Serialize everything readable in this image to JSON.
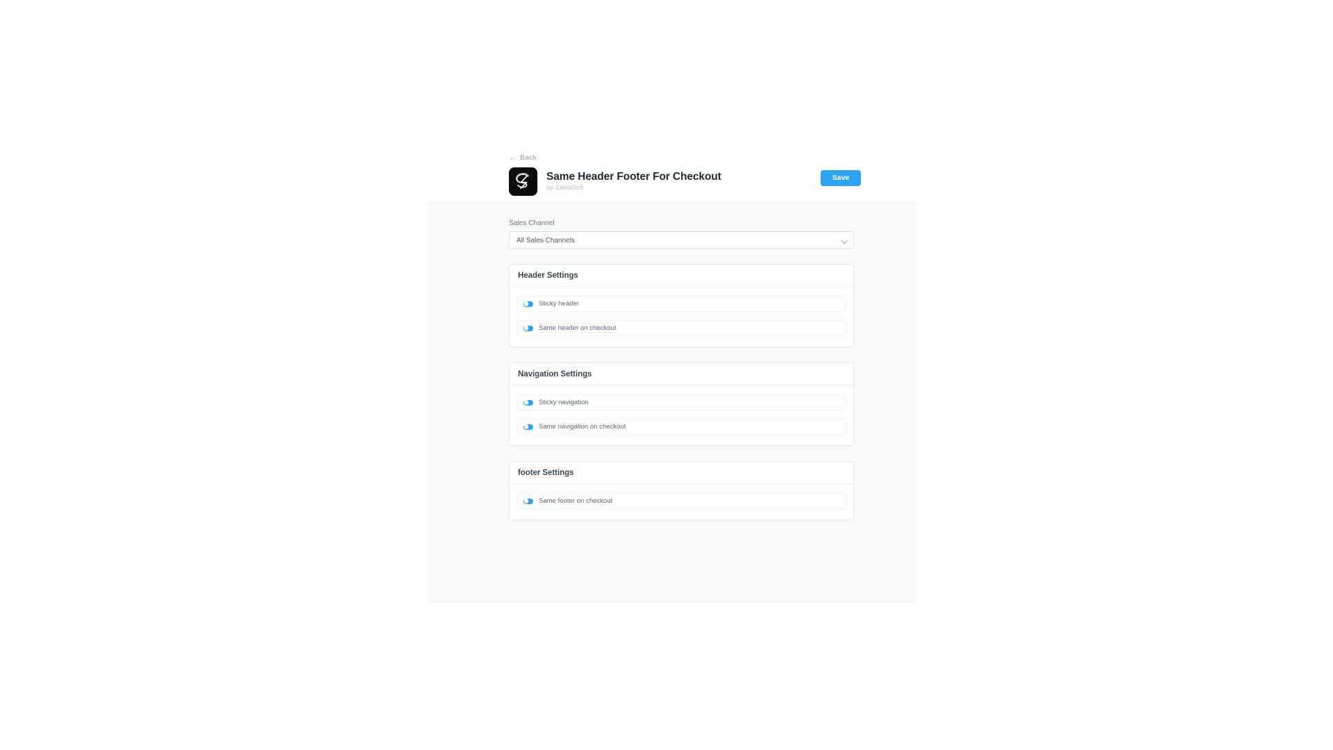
{
  "header": {
    "back_label": "Back",
    "back_icon": "arrow-left-icon",
    "app_title": "Same Header Footer For Checkout",
    "app_author": "by ZainaSoft",
    "logo_icon": "sz-monogram-logo",
    "save_label": "Save"
  },
  "sales_channel": {
    "label": "Sales Channel",
    "selected": "All Sales Channels",
    "chevron_icon": "chevron-down-icon",
    "options": [
      "All Sales Channels"
    ]
  },
  "cards": [
    {
      "title": "Header Settings",
      "toggles": [
        {
          "label": "Sticky header",
          "enabled": true
        },
        {
          "label": "Same header on checkout",
          "enabled": true
        }
      ]
    },
    {
      "title": "Navigation Settings",
      "toggles": [
        {
          "label": "Sticky navigation",
          "enabled": true
        },
        {
          "label": "Same navigation on checkout",
          "enabled": true
        }
      ]
    },
    {
      "title": "footer Settings",
      "toggles": [
        {
          "label": "Same footer on checkout",
          "enabled": true
        }
      ]
    }
  ],
  "colors": {
    "accent": "#2ea3f2",
    "page_background": "#ffffff",
    "content_background": "#f7f9fb",
    "card_background": "#ffffff",
    "card_border": "#e8ebee",
    "title_text": "#1f2733",
    "muted_text": "#9aa3ad",
    "logo_background": "#0d0d0d"
  }
}
